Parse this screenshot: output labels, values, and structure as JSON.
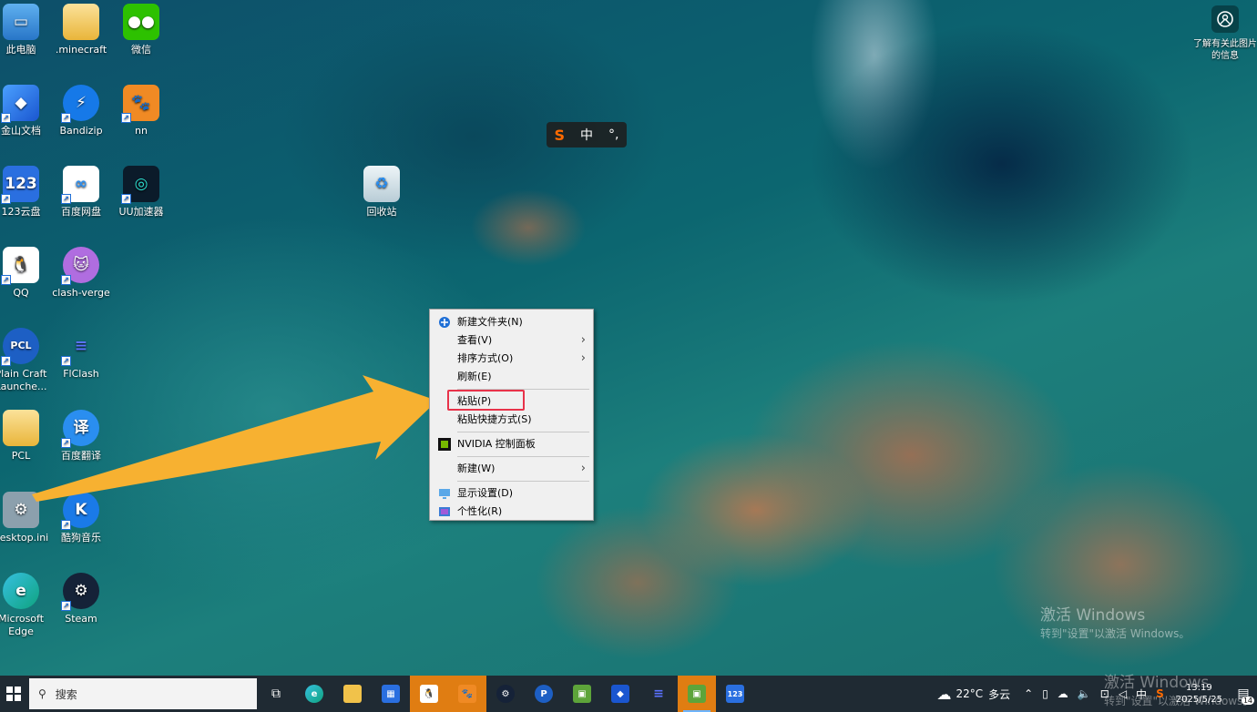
{
  "desktop_icons": [
    {
      "label": "此电脑",
      "icon": "computer-icon",
      "color": "#3b8fe0"
    },
    {
      "label": ".minecraft",
      "icon": "folder-icon",
      "color": "#f1c24a"
    },
    {
      "label": "微信",
      "icon": "wechat-icon",
      "color": "#2dc100"
    },
    {
      "label": "金山文档",
      "icon": "kdocs-icon",
      "color": "#1a6fe0"
    },
    {
      "label": "Bandizip",
      "icon": "bandizip-icon",
      "color": "#1679e8"
    },
    {
      "label": "nn",
      "icon": "nn-icon",
      "color": "#f08a24"
    },
    {
      "label": "123云盘",
      "icon": "123pan-icon",
      "color": "#2a6fe0"
    },
    {
      "label": "百度网盘",
      "icon": "baidu-netdisk-icon",
      "color": "#ffffff"
    },
    {
      "label": "UU加速器",
      "icon": "uu-icon",
      "color": "#0b1b2a"
    },
    {
      "label": "QQ",
      "icon": "qq-icon",
      "color": "#ffffff"
    },
    {
      "label": "clash-verge",
      "icon": "clash-verge-icon",
      "color": "#b06de0"
    },
    {
      "label": "Plain Craft Launche...",
      "icon": "pcl-icon",
      "color": "#1d5fc4"
    },
    {
      "label": "FlClash",
      "icon": "flclash-icon",
      "color": "#3d5ae0"
    },
    {
      "label": "PCL",
      "icon": "folder-icon",
      "color": "#f1c24a"
    },
    {
      "label": "百度翻译",
      "icon": "baidu-translate-icon",
      "color": "#2a8ef0"
    },
    {
      "label": "desktop.ini",
      "icon": "settings-file-icon",
      "color": "#8ca0ad"
    },
    {
      "label": "酷狗音乐",
      "icon": "kugou-icon",
      "color": "#1a7ae8"
    },
    {
      "label": "Microsoft Edge",
      "icon": "edge-icon",
      "color": "#0fa37f"
    },
    {
      "label": "Steam",
      "icon": "steam-icon",
      "color": "#152238"
    },
    {
      "label": "回收站",
      "icon": "recycle-bin-icon",
      "color": "#d8e6ee"
    }
  ],
  "info_button": {
    "label": "了解有关此图片的信息"
  },
  "ime": {
    "s": "S",
    "lang": "中",
    "punct": "°,"
  },
  "context_menu": {
    "items": [
      {
        "label": "新建文件夹(N)",
        "icon": "new-folder-icon",
        "submenu": false
      },
      {
        "label": "查看(V)",
        "icon": "",
        "submenu": true
      },
      {
        "label": "排序方式(O)",
        "icon": "",
        "submenu": true
      },
      {
        "label": "刷新(E)",
        "icon": "",
        "submenu": false
      },
      {
        "label": "粘贴(P)",
        "icon": "",
        "submenu": false
      },
      {
        "label": "粘贴快捷方式(S)",
        "icon": "",
        "submenu": false
      },
      {
        "label": "NVIDIA 控制面板",
        "icon": "nvidia-icon",
        "submenu": false
      },
      {
        "label": "新建(W)",
        "icon": "",
        "submenu": true
      },
      {
        "label": "显示设置(D)",
        "icon": "display-icon",
        "submenu": false
      },
      {
        "label": "个性化(R)",
        "icon": "personalize-icon",
        "submenu": false
      }
    ],
    "highlighted": "粘贴(P)",
    "highlight_color": "#e8334a"
  },
  "annotation_arrow_color": "#f7b131",
  "watermark": {
    "line1": "激活 Windows",
    "line2": "转到\"设置\"以激活 Windows。"
  },
  "taskbar": {
    "search_placeholder": "搜索",
    "weather": {
      "temp": "22°C",
      "condition": "多云"
    },
    "ime_lang": "中",
    "time": "13:19",
    "date": "2025/5/25",
    "notification_count": "14"
  }
}
